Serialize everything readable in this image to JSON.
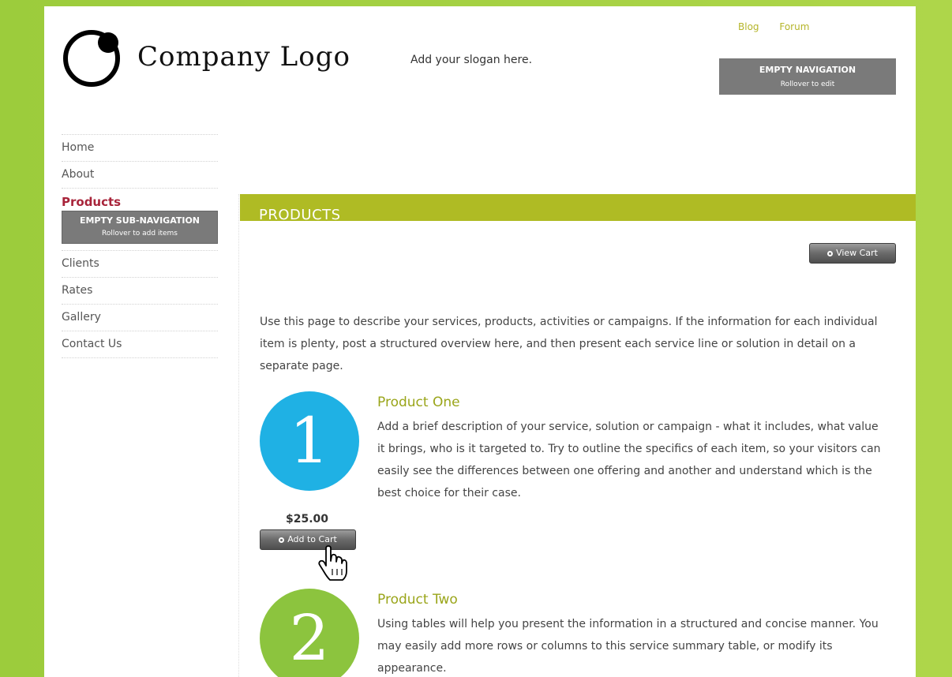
{
  "header": {
    "logo_text": "Company Logo",
    "slogan": "Add your slogan here.",
    "top_links": [
      "Blog",
      "Forum"
    ],
    "empty_navigation": {
      "title": "EMPTY NAVIGATION",
      "subtitle": "Rollover to edit"
    }
  },
  "sidebar": {
    "items": [
      {
        "label": "Home"
      },
      {
        "label": "About"
      },
      {
        "label": "Products"
      },
      {
        "label": "Clients"
      },
      {
        "label": "Rates"
      },
      {
        "label": "Gallery"
      },
      {
        "label": "Contact Us"
      }
    ],
    "active": "Products",
    "sub_navigation": {
      "title": "EMPTY SUB-NAVIGATION",
      "subtitle": "Rollover to add items"
    }
  },
  "main": {
    "section_title": "PRODUCTS",
    "view_cart_label": "View Cart",
    "intro": "Use this page to describe your services, products, activities or campaigns. If the information for each individual item is plenty, post a structured overview here, and then present each service line or solution in detail on a separate page.",
    "products": [
      {
        "number": "1",
        "title": "Product One",
        "description": "Add a brief description of your service, solution or campaign - what it includes, what value it brings, who is it targeted to. Try to outline the specifics of each item, so your visitors can easily see the differences between one offering and another and understand which is the best choice for their case.",
        "price": "$25.00",
        "add_to_cart_label": "Add to Cart",
        "color": "#1fb1e4"
      },
      {
        "number": "2",
        "title": "Product Two",
        "description": "Using tables will help you present the information in a structured and concise manner. You may easily add more rows or columns to this service summary table, or modify its appearance.",
        "color": "#8cc43e"
      }
    ]
  },
  "colors": {
    "accent_bar": "#afbb24",
    "active_nav": "#a8243a",
    "link": "#b5b52a"
  },
  "icons": [
    "company-logo-icon",
    "hand-pointer-cursor-icon",
    "circle-bullet-icon"
  ]
}
